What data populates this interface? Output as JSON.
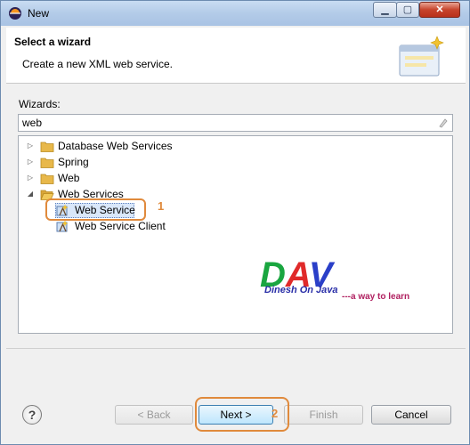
{
  "window": {
    "title": "New"
  },
  "header": {
    "title": "Select a wizard",
    "description": "Create a new XML web service."
  },
  "wizards": {
    "label": "Wizards:",
    "filter_value": "web",
    "tree": [
      {
        "label": "Database Web Services",
        "expanded": false
      },
      {
        "label": "Spring",
        "expanded": false
      },
      {
        "label": "Web",
        "expanded": false
      },
      {
        "label": "Web Services",
        "expanded": true,
        "children": [
          {
            "label": "Web Service",
            "selected": true
          },
          {
            "label": "Web Service Client",
            "selected": false
          }
        ]
      }
    ]
  },
  "annotations": {
    "step1": "1",
    "step2": "2"
  },
  "watermark": {
    "logo": "DAV",
    "name": "Dinesh On Java",
    "tagline": "---a way to learn"
  },
  "buttons": {
    "help": "?",
    "back": "< Back",
    "next": "Next >",
    "finish": "Finish",
    "cancel": "Cancel"
  },
  "colors": {
    "accent_orange": "#e08a3c",
    "folder": "#e8b84a",
    "selection": "#d9e7fa"
  }
}
